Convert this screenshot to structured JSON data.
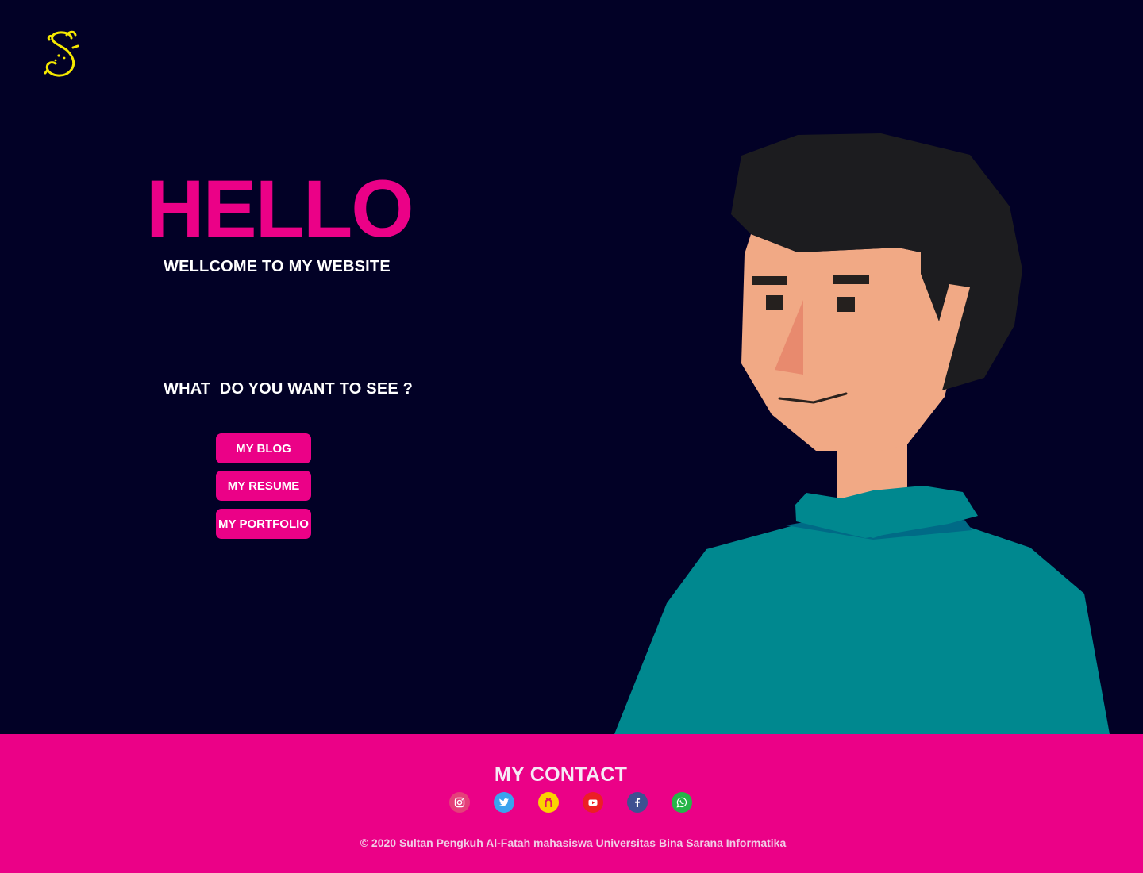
{
  "colors": {
    "background": "#020126",
    "accent": "#eb0187",
    "logo": "#f5e800",
    "skin": "#f1a985",
    "hair": "#1c1c1f",
    "shirt": "#00888f",
    "nose": "#e88a6e"
  },
  "logo": {
    "icon": "s-monogram-logo"
  },
  "hero": {
    "title": "HELLO",
    "subtitle": "WELLCOME TO MY WEBSITE",
    "question": "WHAT  DO YOU WANT TO SEE ?",
    "buttons": [
      {
        "label": "MY BLOG"
      },
      {
        "label": "MY RESUME"
      },
      {
        "label": "MY PORTFOLIO"
      }
    ]
  },
  "illustration": {
    "subject": "man-avatar-illustration"
  },
  "footer": {
    "contact_title": "MY CONTACT",
    "social": [
      {
        "icon": "instagram-icon",
        "color": "#e4407a"
      },
      {
        "icon": "twitter-icon",
        "color": "#3aa3ee"
      },
      {
        "icon": "happy-face-icon",
        "color": "#fbd300"
      },
      {
        "icon": "youtube-icon",
        "color": "#ec1e24"
      },
      {
        "icon": "facebook-icon",
        "color": "#3e5191"
      },
      {
        "icon": "whatsapp-icon",
        "color": "#25b548"
      }
    ],
    "copyright": "© 2020 Sultan Pengkuh Al-Fatah mahasiswa Universitas Bina Sarana Informatika"
  }
}
